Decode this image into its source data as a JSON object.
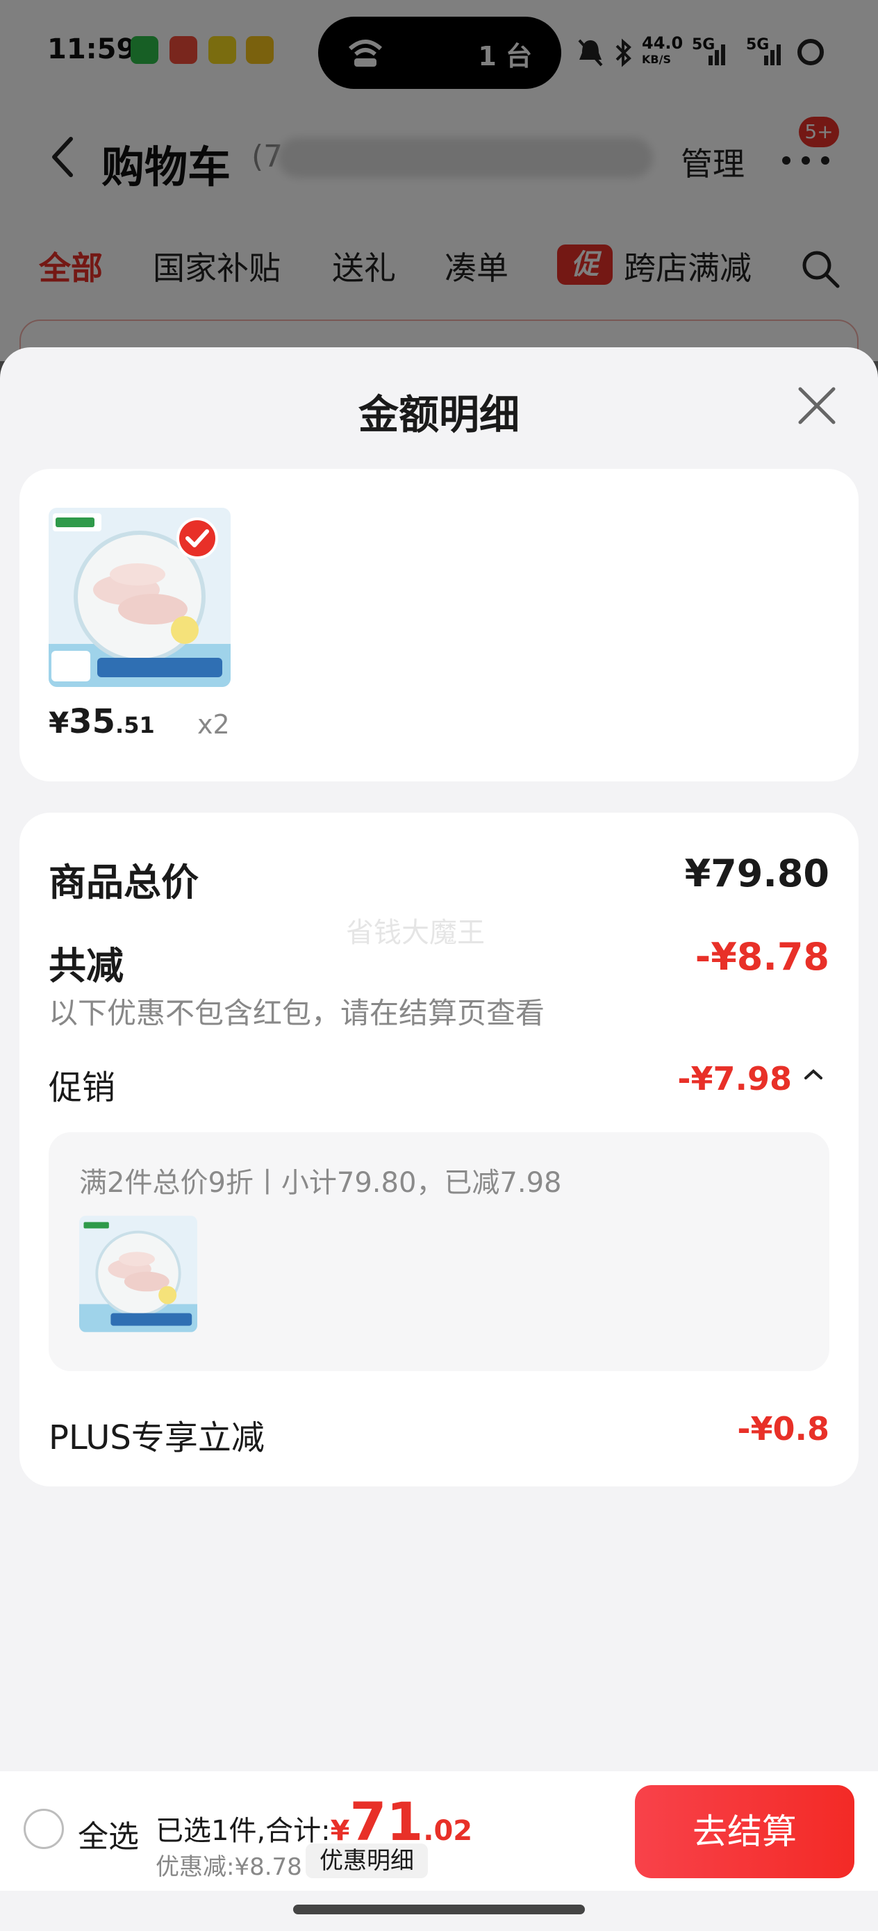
{
  "status_bar": {
    "time": "11:59",
    "island_text": "1 台",
    "network_speed": "44.0",
    "network_unit": "KB/S",
    "net_5g_a": "5G",
    "net_5g_b": "5G",
    "apps": [
      "wechat-icon",
      "app-icon-2",
      "app-icon-3",
      "app-icon-4"
    ]
  },
  "header": {
    "title": "购物车",
    "count_prefix": "(7",
    "manage_label": "管理",
    "message_badge": "5+"
  },
  "filter_tabs": {
    "items": [
      "全部",
      "国家补贴",
      "送礼",
      "凑单",
      "跨店满减"
    ],
    "active_index": 0,
    "promo_tag": "促"
  },
  "sheet": {
    "title": "金额明细",
    "product": {
      "price_currency": "¥",
      "price_int": "35",
      "price_dec": ".51",
      "quantity": "x2",
      "selected": true
    },
    "summary": {
      "goods_total_label": "商品总价",
      "goods_total_value": "¥79.80",
      "total_discount_label": "共减",
      "total_discount_value": "-¥8.78",
      "note": "以下优惠不包含红包，请在结算页查看",
      "watermark": "省钱大魔王",
      "promo_label": "促销",
      "promo_value": "-¥7.98",
      "promo_desc": "满2件总价9折丨小计79.80，已减7.98",
      "plus_label": "PLUS专享立减",
      "plus_value": "-¥0.8"
    }
  },
  "checkout": {
    "select_all_label": "全选",
    "selected_text": "已选1件,合计:",
    "total_currency": "¥",
    "total_int": "71",
    "total_dec": ".02",
    "discount_text": "优惠减:¥8.78",
    "discount_detail_label": "优惠明细",
    "checkout_label": "去结算"
  },
  "colors": {
    "accent": "#e83028",
    "sheet_bg": "#f3f3f5"
  }
}
